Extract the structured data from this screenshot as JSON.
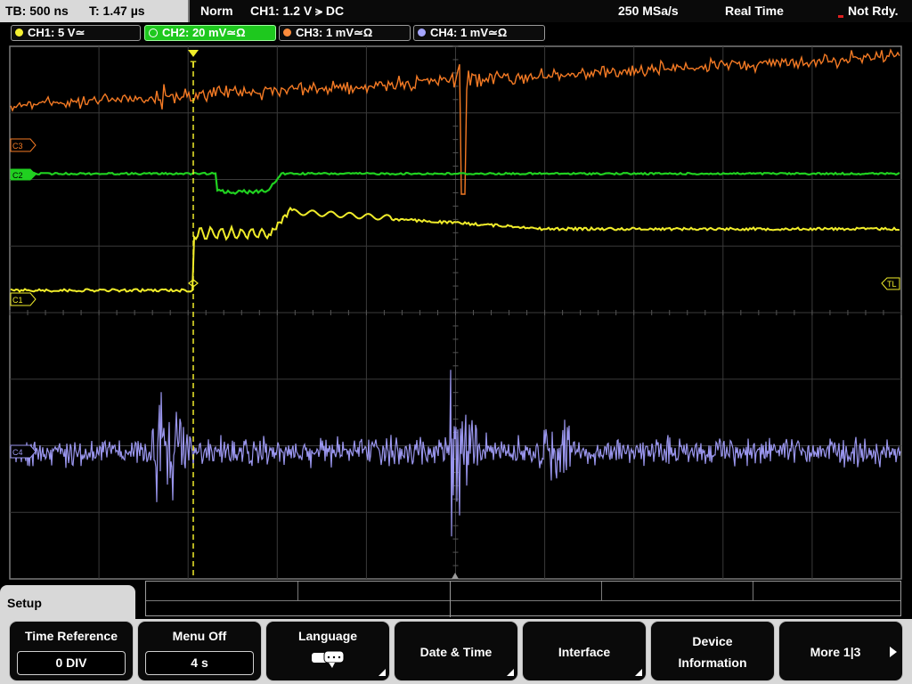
{
  "top": {
    "timebase": "TB: 500 ns",
    "trigger_time": "T: 1.47 µs",
    "mode": "Norm",
    "trigger_info": "CH1: 1.2 V ⪫ DC",
    "sample_rate": "250 MSa/s",
    "acq_mode": "Real Time",
    "status": "Not Rdy."
  },
  "channels": [
    {
      "label": "CH1: 5 V≃",
      "color": "#f5f032"
    },
    {
      "label": "CH2: 20 mV≃Ω",
      "color": "#ffffff"
    },
    {
      "label": "CH3: 1 mV≃Ω",
      "color": "#ff8c3c"
    },
    {
      "label": "CH4: 1 mV≃Ω",
      "color": "#a6a6ff"
    }
  ],
  "markers": {
    "c3": "C3",
    "c2": "C2",
    "c1": "C1",
    "c4": "C4",
    "tl": "TL",
    "trigger": "T"
  },
  "colors": {
    "ch1": "#f0ec2a",
    "ch2": "#20d020",
    "ch3": "#f47a24",
    "ch4": "#9a96ee"
  },
  "menu": {
    "title": "Setup",
    "time_reference": {
      "label": "Time Reference",
      "value": "0 DIV"
    },
    "menu_off": {
      "label": "Menu Off",
      "value": "4 s"
    },
    "language": {
      "label": "Language",
      "icon": "speech-bubbles-icon"
    },
    "date_time": {
      "label": "Date & Time"
    },
    "interface": {
      "label": "Interface"
    },
    "device_info": {
      "label1": "Device",
      "label2": "Information"
    },
    "more": {
      "label": "More 1|3",
      "icon": "arrow-right-icon"
    }
  }
}
